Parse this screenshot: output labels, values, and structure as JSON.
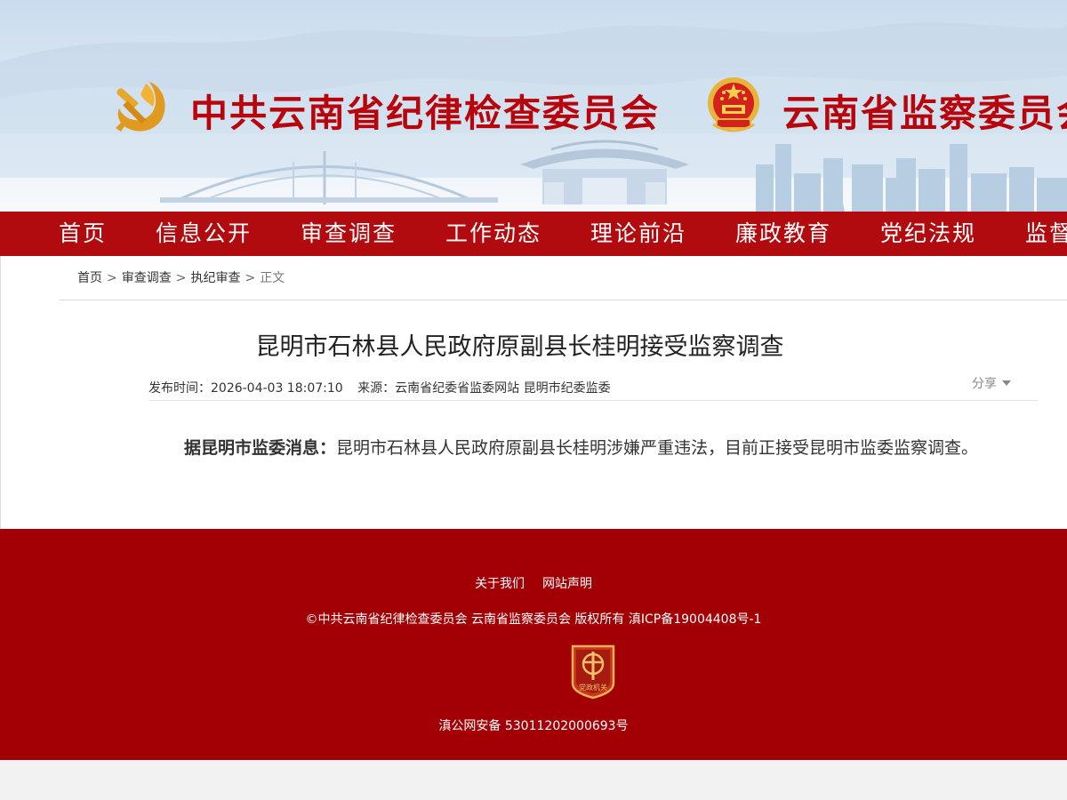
{
  "header": {
    "party_org": "中共云南省纪律检查委员会",
    "gov_org": "云南省监察委员会"
  },
  "nav": {
    "items": [
      "首页",
      "信息公开",
      "审查调查",
      "工作动态",
      "理论前沿",
      "廉政教育",
      "党纪法规",
      "监督"
    ]
  },
  "breadcrumb": {
    "items": [
      "首页",
      "审查调查",
      "执纪审查"
    ],
    "current": "正文",
    "separator": ">"
  },
  "article": {
    "title": "昆明市石林县人民政府原副县长桂明接受监察调查",
    "publish_label": "发布时间：",
    "publish_time": "2026-04-03 18:07:10",
    "source_label": "来源：",
    "source": "云南省纪委省监委网站 昆明市纪委监委",
    "share_label": "分享",
    "lead": "据昆明市监委消息：",
    "body": "昆明市石林县人民政府原副县长桂明涉嫌严重违法，目前正接受昆明市监委监察调查。"
  },
  "footer": {
    "links": [
      "关于我们",
      "网站声明"
    ],
    "copyright": "©中共云南省纪律检查委员会 云南省监察委员会 版权所有 滇ICP备19004408号-1",
    "badge_text": "党政机关",
    "police_record": "滇公网安备 53011202000693号"
  },
  "colors": {
    "brand_red": "#b10b0f",
    "footer_red": "#a30006",
    "title_red": "#b8050b",
    "emblem_gold": "#f2b233"
  },
  "icons": [
    "party-emblem-icon",
    "national-emblem-icon",
    "share-caret-icon",
    "gov-badge-icon"
  ]
}
